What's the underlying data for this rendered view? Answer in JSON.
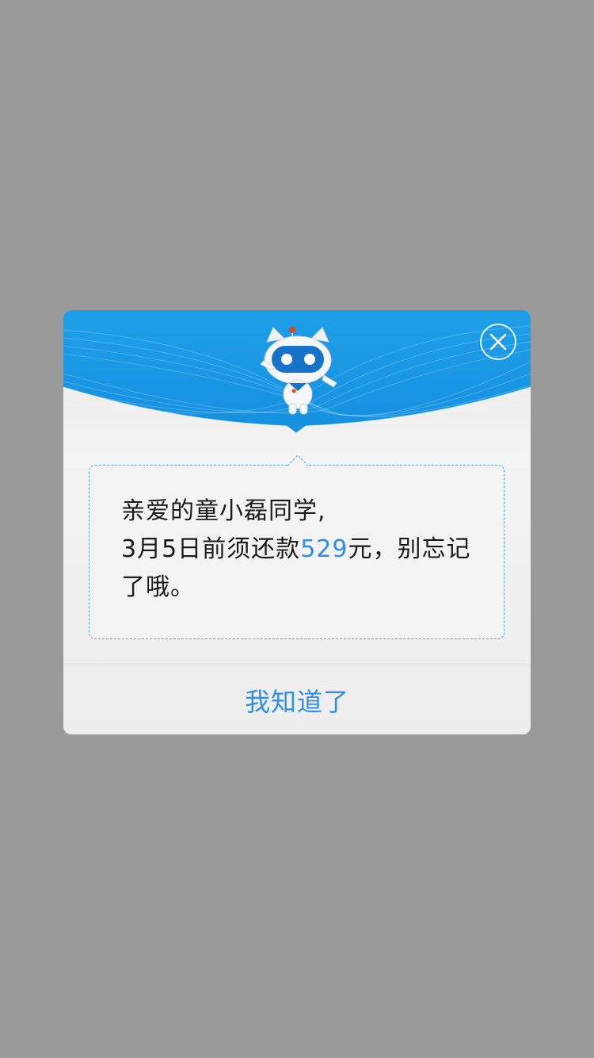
{
  "dialog": {
    "message": {
      "line1": "亲爱的童小磊同学,",
      "line2_prefix": "3月5日前须还款",
      "amount": "529",
      "line2_suffix": "元，别忘记",
      "line3": "了哦。"
    },
    "confirm_label": "我知道了",
    "close_icon": "close-icon",
    "mascot_icon": "robot-cat-mascot"
  },
  "colors": {
    "overlay": "#9a9a9a",
    "header_blue": "#1a9be6",
    "accent": "#2f8fe6"
  }
}
